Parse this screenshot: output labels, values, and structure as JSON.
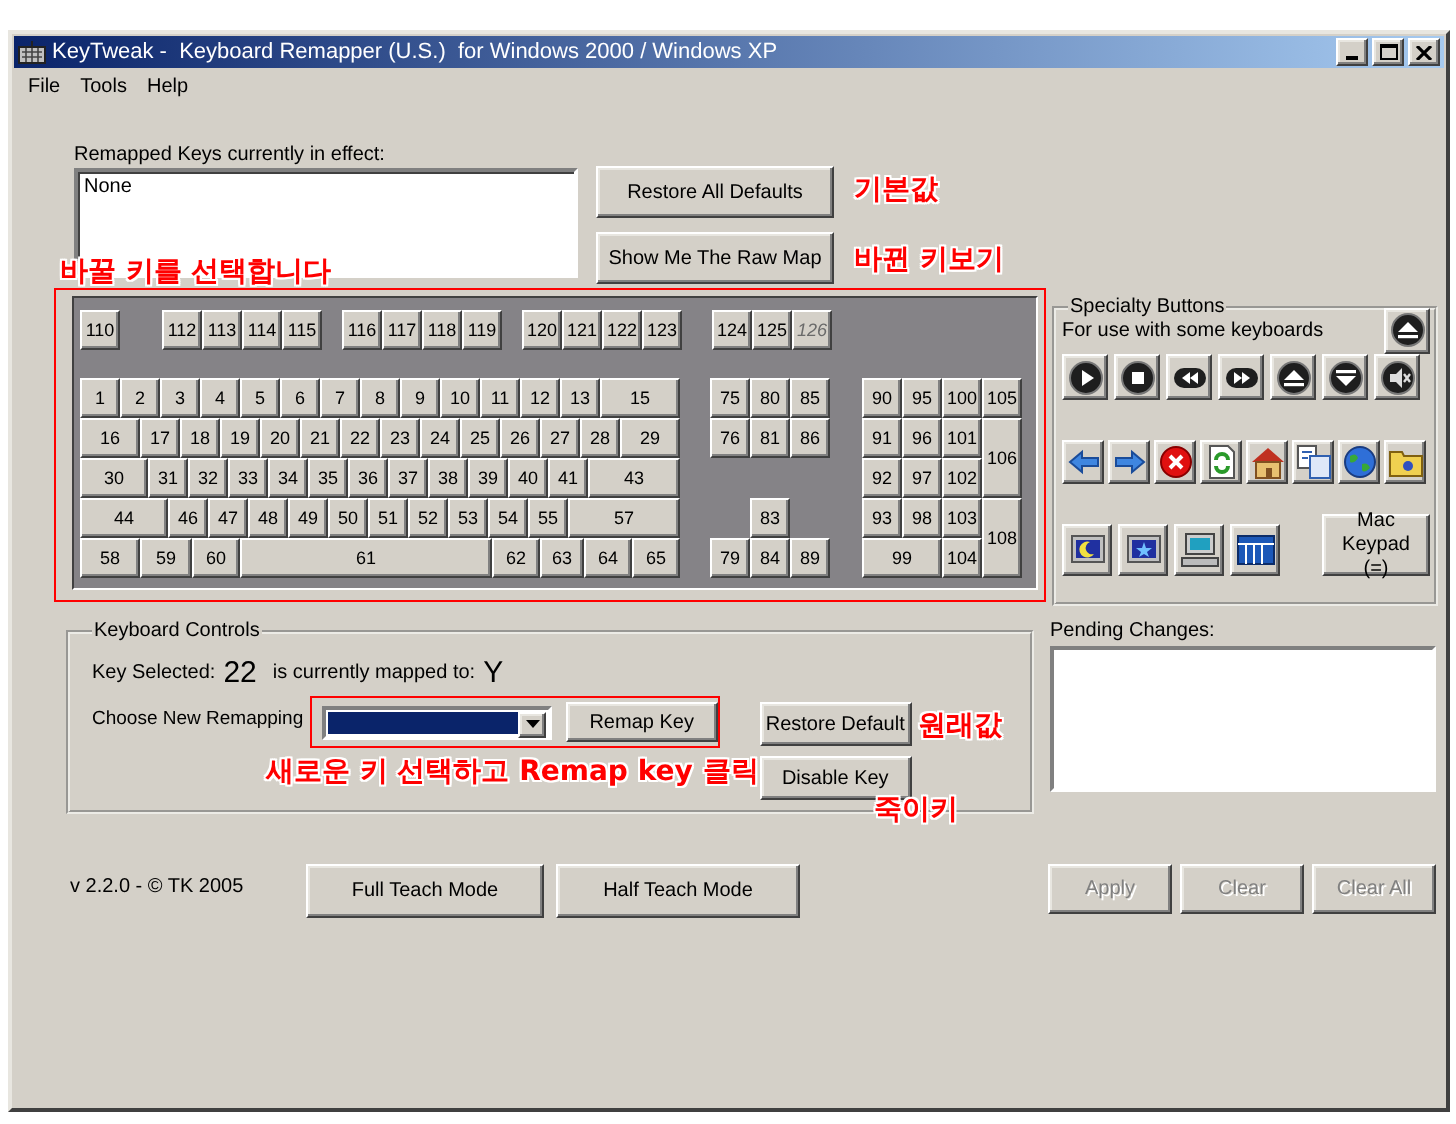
{
  "window": {
    "title": "KeyTweak -  Keyboard Remapper (U.S.)  for Windows 2000 / Windows XP"
  },
  "menu": [
    {
      "label": "File"
    },
    {
      "label": "Tools"
    },
    {
      "label": "Help"
    }
  ],
  "remapped": {
    "label": "Remapped Keys currently in effect:",
    "items": [
      "None"
    ]
  },
  "top_buttons": [
    "Restore All Defaults",
    "Show Me The Raw Map"
  ],
  "keyboard": {
    "function_keys": [
      {
        "label": "110",
        "disabled": false
      },
      {
        "label": "112",
        "disabled": false
      },
      {
        "label": "113",
        "disabled": false
      },
      {
        "label": "114",
        "disabled": false
      },
      {
        "label": "115",
        "disabled": false
      },
      {
        "label": "116",
        "disabled": false
      },
      {
        "label": "117",
        "disabled": false
      },
      {
        "label": "118",
        "disabled": false
      },
      {
        "label": "119",
        "disabled": false
      },
      {
        "label": "120",
        "disabled": false
      },
      {
        "label": "121",
        "disabled": false
      },
      {
        "label": "122",
        "disabled": false
      },
      {
        "label": "123",
        "disabled": false
      },
      {
        "label": "124",
        "disabled": false
      },
      {
        "label": "125",
        "disabled": false
      },
      {
        "label": "126",
        "disabled": true
      }
    ],
    "main_rows": [
      [
        "1",
        "2",
        "3",
        "4",
        "5",
        "6",
        "7",
        "8",
        "9",
        "10",
        "11",
        "12",
        "13",
        "15"
      ],
      [
        "16",
        "17",
        "18",
        "19",
        "20",
        "21",
        "22",
        "23",
        "24",
        "25",
        "26",
        "27",
        "28",
        "29"
      ],
      [
        "30",
        "31",
        "32",
        "33",
        "34",
        "35",
        "36",
        "37",
        "38",
        "39",
        "40",
        "41",
        "43"
      ],
      [
        "44",
        "46",
        "47",
        "48",
        "49",
        "50",
        "51",
        "52",
        "53",
        "54",
        "55",
        "57"
      ],
      [
        "58",
        "59",
        "60",
        "61",
        "62",
        "63",
        "64",
        "65"
      ]
    ],
    "nav_keys": [
      "75",
      "80",
      "85",
      "76",
      "81",
      "86",
      "83",
      "79",
      "84",
      "89"
    ],
    "numpad_keys": [
      "90",
      "95",
      "100",
      "105",
      "91",
      "96",
      "101",
      "106",
      "92",
      "97",
      "102",
      "93",
      "98",
      "103",
      "108",
      "99",
      "104"
    ]
  },
  "specialty": {
    "title": "Specialty Buttons",
    "subtitle": "For use with some keyboards",
    "mac_keypad": "Mac Keypad (=)"
  },
  "keyboard_controls": {
    "title": "Keyboard Controls",
    "key_selected_label": "Key Selected:",
    "key_selected_value": "22",
    "mapped_label": "is currently mapped to:",
    "mapped_value": "Y",
    "remapping_label": "Choose New Remapping",
    "remap_button": "Remap Key",
    "restore_button": "Restore Default",
    "disable_button": "Disable Key"
  },
  "pending": {
    "label": "Pending Changes:"
  },
  "version": "v 2.2.0 - © TK 2005",
  "teach_buttons": [
    "Full Teach Mode",
    "Half Teach Mode"
  ],
  "action_buttons": [
    {
      "label": "Apply",
      "disabled": true
    },
    {
      "label": "Clear",
      "disabled": true
    },
    {
      "label": "Clear All",
      "disabled": true
    }
  ],
  "annotations": [
    {
      "text": "기본값"
    },
    {
      "text": "바뀐 키보기"
    },
    {
      "text": "바꿀 키를 선택합니다"
    },
    {
      "text": "원래값"
    },
    {
      "text": "새로운 키 선택하고 Remap key 클릭"
    },
    {
      "text": "죽이키"
    }
  ]
}
